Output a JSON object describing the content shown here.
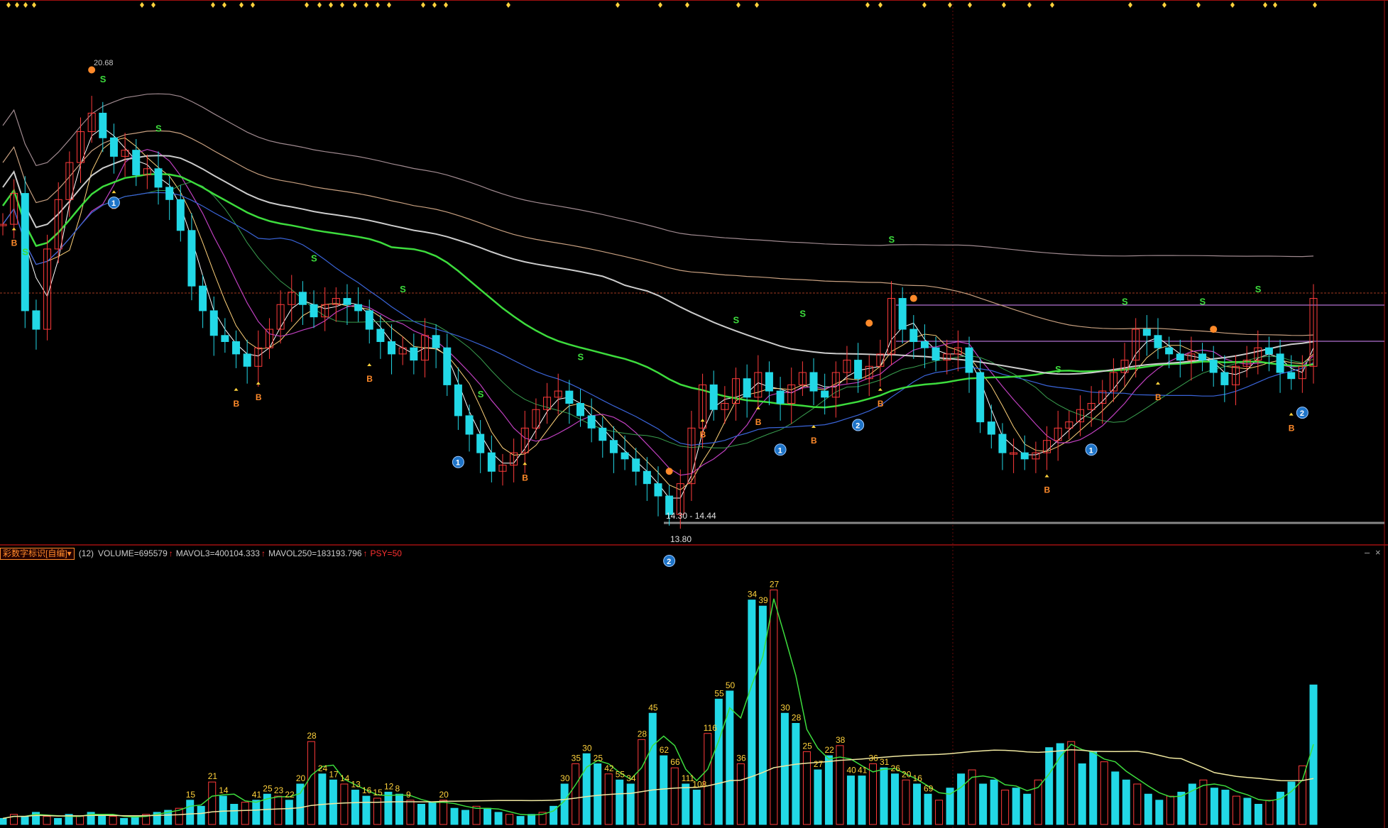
{
  "indicator_bar": {
    "selector_label": "彩数字标识[自编]",
    "count": "(12)",
    "volume": "VOLUME=695579",
    "mavol3": "MAVOL3=400104.333",
    "mavol250": "MAVOL250=183193.796",
    "psy": "PSY=50",
    "up_arrow": "↑",
    "minimize": "–",
    "close": "×"
  },
  "colors": {
    "background": "#000000",
    "up_candle": "#ff3b3b",
    "down_candle": "#22d8e6",
    "ma_short": "#ffffff",
    "ma_mid": "#ff5a5a",
    "ma_green": "#3ddc3d",
    "ma_blue": "#3a64d8",
    "ma_purple": "#c040c0",
    "ma_long": "#c8a080",
    "label_yellow": "#ffd23c",
    "signal_orange": "#ff8a2a",
    "signal_green": "#3ddc3d",
    "psy_red": "#ff3030"
  },
  "chart_data": [
    {
      "type": "candlestick",
      "title": "",
      "price_labels": {
        "high": "20.68",
        "low": "13.80",
        "range": "14.30 - 14.44"
      },
      "close_series": [
        18.6,
        19.1,
        17.2,
        16.9,
        18.2,
        19.0,
        19.6,
        20.1,
        20.4,
        20.0,
        19.7,
        19.8,
        19.4,
        19.5,
        19.2,
        19.0,
        18.5,
        17.6,
        17.2,
        16.8,
        16.7,
        16.5,
        16.3,
        16.6,
        16.9,
        17.3,
        17.5,
        17.3,
        17.1,
        17.3,
        17.4,
        17.3,
        17.2,
        16.9,
        16.7,
        16.5,
        16.6,
        16.4,
        16.8,
        16.6,
        16.0,
        15.5,
        15.2,
        14.9,
        14.6,
        14.7,
        14.9,
        15.3,
        15.6,
        15.8,
        15.9,
        15.7,
        15.5,
        15.3,
        15.1,
        14.9,
        14.8,
        14.6,
        14.4,
        14.2,
        13.9,
        14.4,
        15.3,
        16.0,
        15.6,
        15.7,
        16.1,
        15.8,
        16.2,
        15.9,
        15.7,
        16.0,
        16.2,
        15.9,
        15.8,
        16.2,
        16.4,
        16.1,
        16.3,
        16.5,
        17.4,
        16.9,
        16.7,
        16.6,
        16.4,
        16.5,
        16.6,
        16.2,
        15.4,
        15.2,
        14.9,
        14.9,
        14.8,
        14.9,
        15.1,
        15.3,
        15.4,
        15.6,
        15.7,
        15.9,
        16.2,
        16.4,
        16.9,
        16.8,
        16.6,
        16.5,
        16.4,
        16.5,
        16.4,
        16.2,
        16.0,
        16.3,
        16.4,
        16.6,
        16.5,
        16.2,
        16.1,
        16.3,
        17.4
      ],
      "signal_labels": [
        "S",
        "B",
        "1",
        "2"
      ],
      "volume_labels": [
        "15",
        "21",
        "14",
        "41",
        "25",
        "23",
        "22",
        "20",
        "28",
        "24",
        "17",
        "14",
        "13",
        "16",
        "15",
        "12",
        "8",
        "9",
        "20",
        "30",
        "35",
        "30",
        "25",
        "42",
        "55",
        "34",
        "28",
        "45",
        "62",
        "66",
        "111",
        "108",
        "116",
        "55",
        "50",
        "36",
        "34",
        "39",
        "27",
        "30",
        "28",
        "25",
        "27",
        "22",
        "38",
        "40",
        "41",
        "36",
        "31",
        "26",
        "20",
        "16",
        "69"
      ]
    },
    {
      "type": "bar",
      "title": "VOLUME",
      "values": [
        3,
        5,
        4,
        6,
        4,
        3,
        5,
        4,
        6,
        5,
        4,
        3,
        4,
        5,
        6,
        7,
        8,
        12,
        9,
        21,
        14,
        10,
        11,
        12,
        15,
        14,
        12,
        20,
        41,
        25,
        22,
        20,
        17,
        14,
        13,
        16,
        15,
        12,
        10,
        11,
        12,
        8,
        7,
        9,
        8,
        6,
        5,
        4,
        5,
        6,
        9,
        20,
        30,
        35,
        30,
        25,
        22,
        20,
        42,
        55,
        34,
        28,
        20,
        17,
        45,
        62,
        66,
        30,
        111,
        108,
        116,
        55,
        50,
        36,
        27,
        34,
        39,
        24,
        24,
        30,
        28,
        25,
        22,
        20,
        15,
        12,
        18,
        25,
        27,
        20,
        22,
        17,
        18,
        15,
        22,
        38,
        40,
        41,
        30,
        36,
        31,
        26,
        22,
        20,
        15,
        12,
        14,
        16,
        20,
        22,
        18,
        17,
        14,
        13,
        10,
        12,
        16,
        21,
        29,
        69
      ]
    }
  ]
}
